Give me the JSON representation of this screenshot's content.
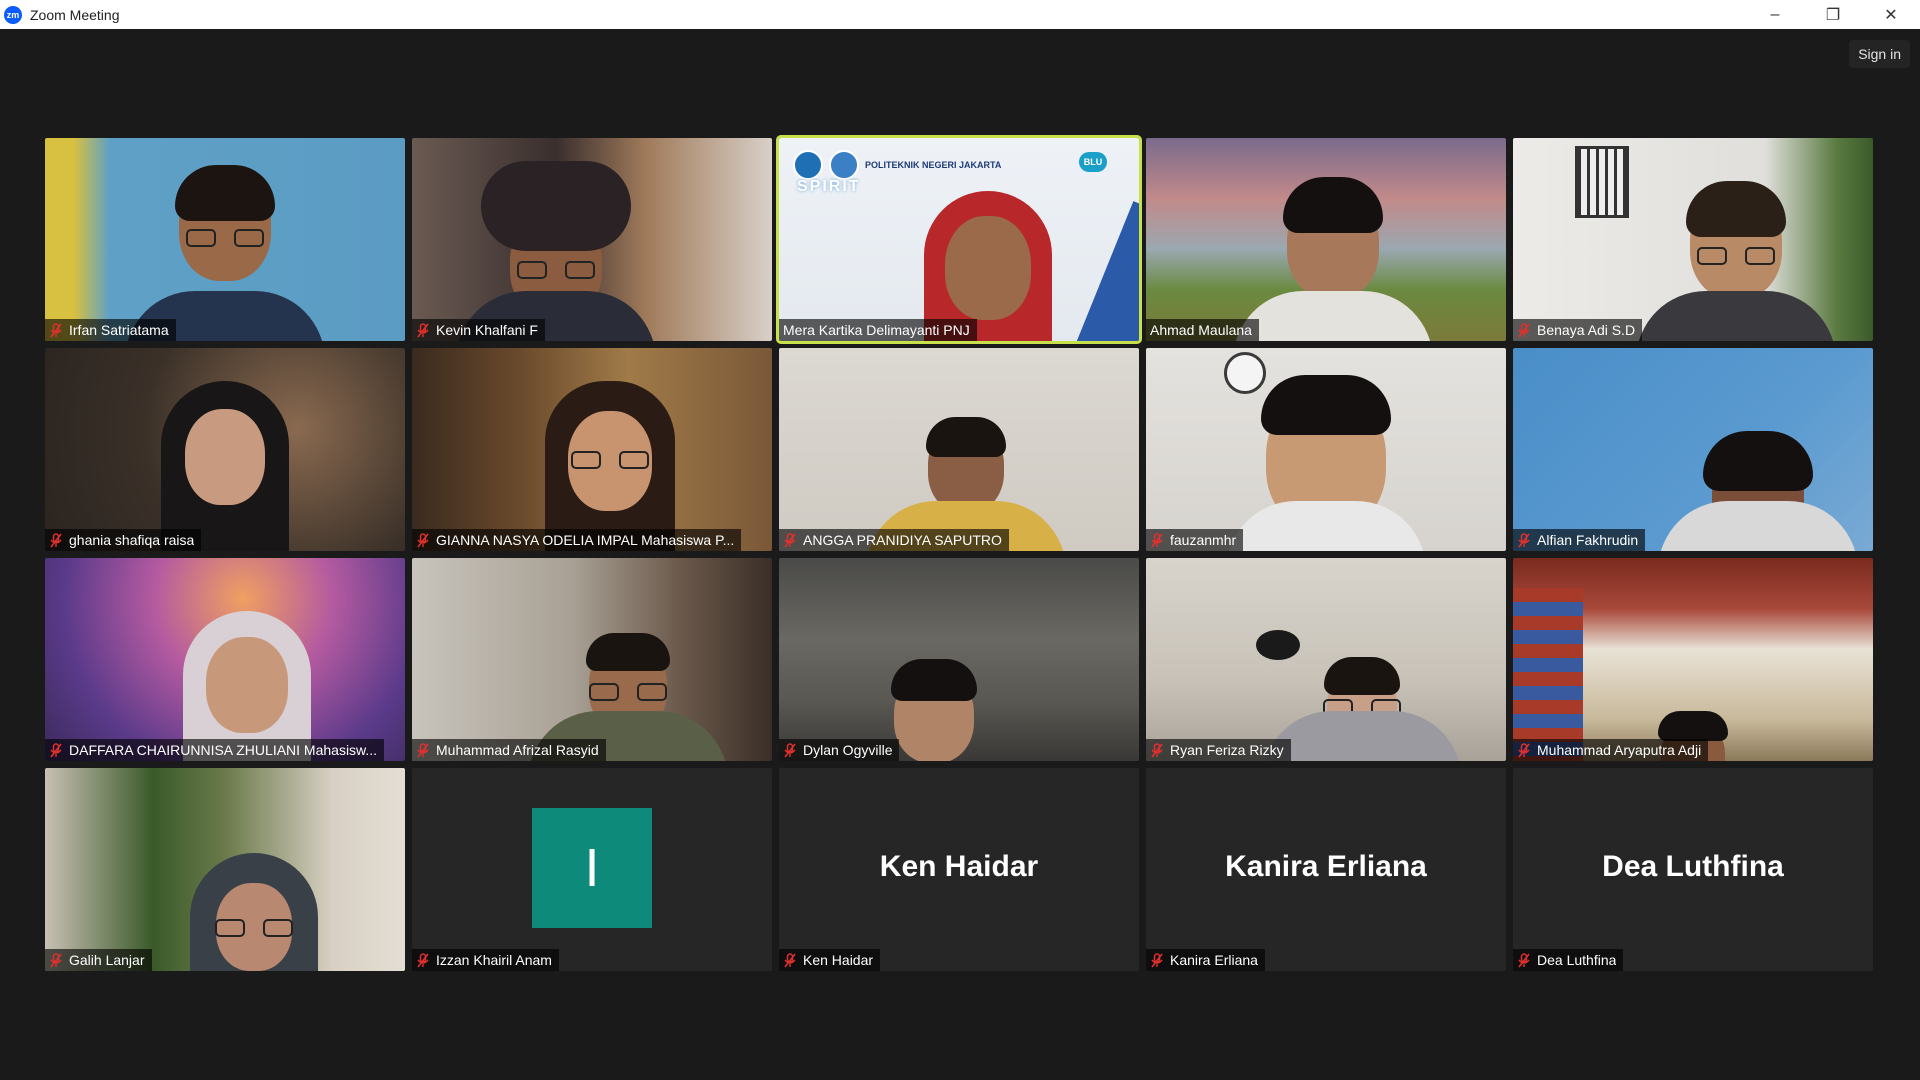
{
  "window": {
    "title": "Zoom Meeting",
    "logo_text": "zm"
  },
  "controls": {
    "minimize": "–",
    "maximize": "❐",
    "close": "✕"
  },
  "signin": {
    "label": "Sign in"
  },
  "slide": {
    "org": "POLITEKNIK NEGERI JAKARTA",
    "spirit": "SPIRIT",
    "blu": "BLU"
  },
  "participants": [
    {
      "name": "Irfan Satriatama",
      "muted": true
    },
    {
      "name": "Kevin Khalfani F",
      "muted": true
    },
    {
      "name": "Mera Kartika Delimayanti PNJ",
      "muted": false,
      "active": true
    },
    {
      "name": "Ahmad Maulana",
      "muted": false
    },
    {
      "name": "Benaya Adi S.D",
      "muted": true
    },
    {
      "name": "ghania shafiqa raisa",
      "muted": true
    },
    {
      "name": "GIANNA NASYA ODELIA IMPAL Mahasiswa P...",
      "muted": true
    },
    {
      "name": "ANGGA PRANIDIYA SAPUTRO",
      "muted": true
    },
    {
      "name": "fauzanmhr",
      "muted": true
    },
    {
      "name": "Alfian Fakhrudin",
      "muted": true
    },
    {
      "name": "DAFFARA CHAIRUNNISA ZHULIANI Mahasisw...",
      "muted": true
    },
    {
      "name": "Muhammad Afrizal Rasyid",
      "muted": true
    },
    {
      "name": "Dylan Ogyville",
      "muted": true
    },
    {
      "name": "Ryan Feriza Rizky",
      "muted": true
    },
    {
      "name": "Muhammad Aryaputra Adji",
      "muted": true
    },
    {
      "name": "Galih Lanjar",
      "muted": true
    },
    {
      "name": "Izzan Khairil Anam",
      "muted": true,
      "initial": "I"
    },
    {
      "name": "Ken Haidar",
      "muted": true,
      "video_off": true
    },
    {
      "name": "Kanira Erliana",
      "muted": true,
      "video_off": true
    },
    {
      "name": "Dea Luthfina",
      "muted": true,
      "video_off": true
    }
  ],
  "colors": {
    "speaker_highlight": "#c8e04a",
    "muted_icon": "#e0302e",
    "avatar_teal": "#0e8a7a"
  }
}
